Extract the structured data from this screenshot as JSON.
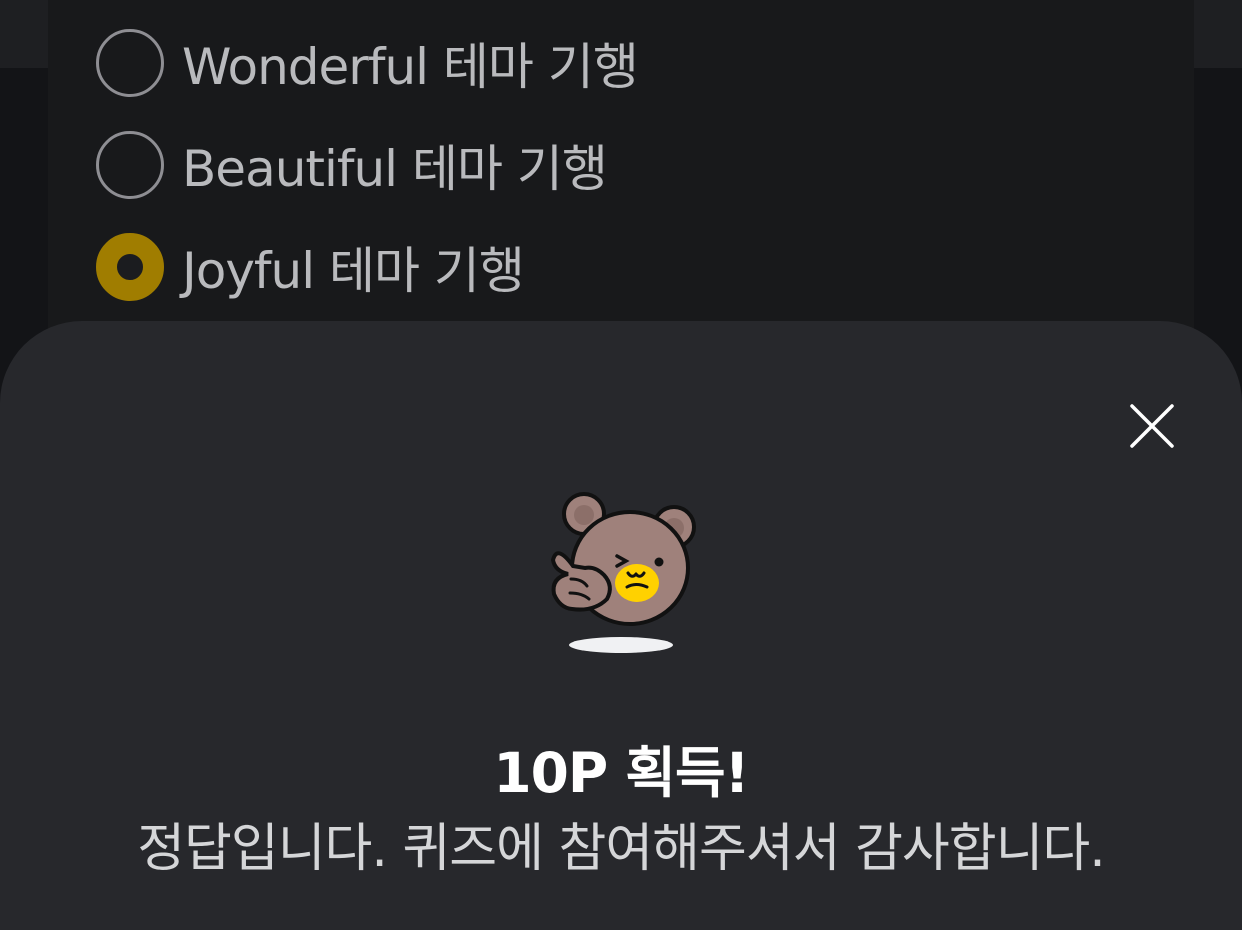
{
  "quiz": {
    "options": [
      {
        "label": "Wonderful 테마 기행",
        "selected": false
      },
      {
        "label": "Beautiful 테마 기행",
        "selected": false
      },
      {
        "label": "Joyful 테마 기행",
        "selected": true
      }
    ]
  },
  "result_sheet": {
    "title": "10P 획득!",
    "message": "정답입니다. 퀴즈에 참여해주셔서 감사합니다.",
    "close_icon": "close-icon",
    "mascot_icon": "bear-thumbs-up-icon"
  },
  "colors": {
    "accent": "#a07d00",
    "sheet_background": "#27282c",
    "page_background": "#131417"
  }
}
